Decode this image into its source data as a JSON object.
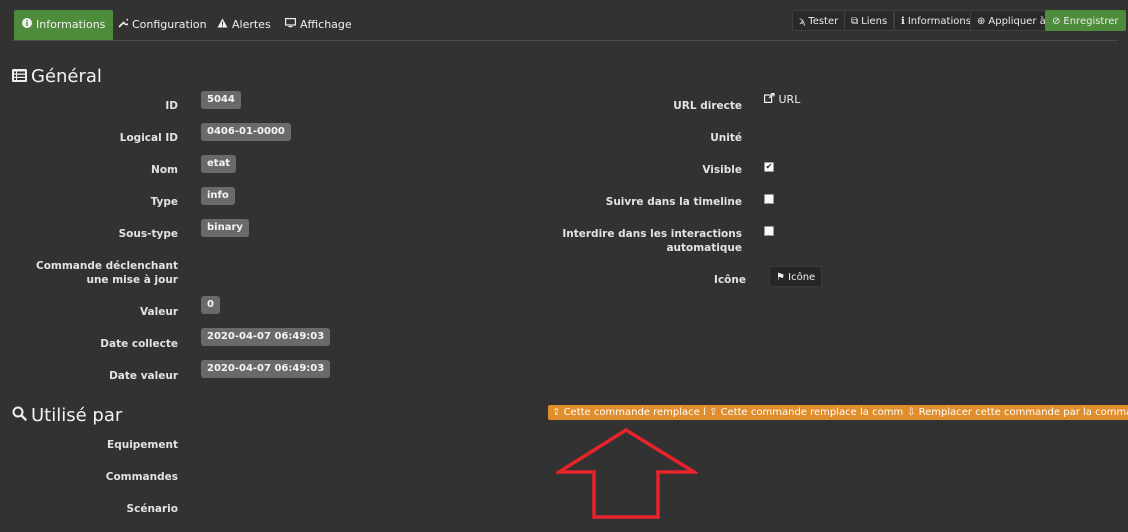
{
  "tabs": [
    {
      "label": "Informations",
      "icon": "info-circle-icon",
      "active": true
    },
    {
      "label": "Configuration",
      "icon": "wrench-icon",
      "active": false
    },
    {
      "label": "Alertes",
      "icon": "warning-icon",
      "active": false
    },
    {
      "label": "Affichage",
      "icon": "monitor-icon",
      "active": false
    }
  ],
  "actions": [
    {
      "label": "Tester",
      "icon": "rss-icon"
    },
    {
      "label": "Liens",
      "icon": "links-icon"
    },
    {
      "label": "Informations",
      "icon": "info-icon"
    },
    {
      "label": "Appliquer à",
      "icon": "plus-circle-icon"
    },
    {
      "label": "Enregistrer",
      "icon": "check-circle-icon",
      "color": "#4e8c3b"
    }
  ],
  "general": {
    "title": "Général",
    "fields": [
      {
        "label": "ID",
        "value": "5044"
      },
      {
        "label": "Logical ID",
        "value": "0406-01-0000"
      },
      {
        "label": "Nom",
        "value": "etat"
      },
      {
        "label": "Type",
        "value": "info"
      },
      {
        "label": "Sous-type",
        "value": "binary"
      },
      {
        "label": "Commande déclenchant une mise à jour",
        "value": ""
      },
      {
        "label": "Valeur",
        "value": "0"
      },
      {
        "label": "Date collecte",
        "value": "2020-04-07 06:49:03"
      },
      {
        "label": "Date valeur",
        "value": "2020-04-07 06:49:03"
      }
    ],
    "right": {
      "url_label": "URL directe",
      "url_link": "URL",
      "unite_label": "Unité",
      "visible_label": "Visible",
      "visible_checked": true,
      "timeline_label": "Suivre dans la timeline",
      "timeline_checked": false,
      "interactions_label": "Interdire dans les interactions automatique",
      "interactions_checked": false,
      "icone_label": "Icône",
      "icone_button": "Icône"
    }
  },
  "used_by": {
    "title": "Utilisé par",
    "labels": [
      "Equipement",
      "Commandes",
      "Scénario"
    ],
    "buttons": [
      "Cette commande remplace l'ID",
      "Cette commande remplace la commande",
      "Remplacer cette commande par la commande"
    ]
  },
  "colors": {
    "accent": "#4e8c3b",
    "orange": "#e08d2b",
    "annotation_arrow": "#e8232a",
    "background": "#323232"
  }
}
